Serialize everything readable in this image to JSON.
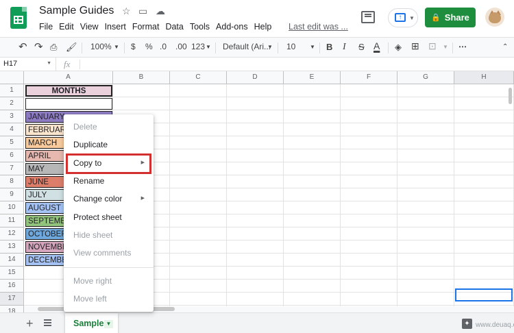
{
  "header": {
    "doc_title": "Sample Guides",
    "menu": [
      "File",
      "Edit",
      "View",
      "Insert",
      "Format",
      "Data",
      "Tools",
      "Add-ons",
      "Help"
    ],
    "last_edit": "Last edit was ...",
    "share_label": "Share"
  },
  "toolbar": {
    "zoom": "100%",
    "currency": "$",
    "percent": "%",
    "dec_less": ".0",
    "dec_more": ".00",
    "more_formats": "123",
    "font": "Default (Ari...",
    "font_size": "10",
    "bold": "B",
    "italic": "I",
    "strike": "S",
    "text_color": "A"
  },
  "formula_bar": {
    "name_box": "H17",
    "fx_label": "fx"
  },
  "grid": {
    "columns": [
      "A",
      "B",
      "C",
      "D",
      "E",
      "F",
      "G",
      "H"
    ],
    "rows": [
      "1",
      "2",
      "3",
      "4",
      "5",
      "6",
      "7",
      "8",
      "9",
      "10",
      "11",
      "12",
      "13",
      "14",
      "15",
      "16",
      "17",
      "18"
    ],
    "cells": [
      {
        "row": 1,
        "text": "MONTHS",
        "bg": "#ead1dc"
      },
      {
        "row": 2,
        "text": "",
        "bg": "#ffffff"
      },
      {
        "row": 3,
        "text": "JANUARY",
        "bg": "#8e7cc3"
      },
      {
        "row": 4,
        "text": "FEBRUARY",
        "bg": "#fce5cd"
      },
      {
        "row": 5,
        "text": "MARCH",
        "bg": "#f9cb9c"
      },
      {
        "row": 6,
        "text": "APRIL",
        "bg": "#e6b8af"
      },
      {
        "row": 7,
        "text": "MAY",
        "bg": "#b7b7b7"
      },
      {
        "row": 8,
        "text": "JUNE",
        "bg": "#dd7e6b"
      },
      {
        "row": 9,
        "text": "JULY",
        "bg": "#d0e0e3"
      },
      {
        "row": 10,
        "text": "AUGUST",
        "bg": "#a4c2f4"
      },
      {
        "row": 11,
        "text": "SEPTEMBER",
        "bg": "#93c47d"
      },
      {
        "row": 12,
        "text": "OCTOBER",
        "bg": "#6fa8dc"
      },
      {
        "row": 13,
        "text": "NOVEMBER",
        "bg": "#d5a6bd"
      },
      {
        "row": 14,
        "text": "DECEMBER",
        "bg": "#a4c2f4"
      }
    ]
  },
  "context_menu": {
    "items": [
      {
        "label": "Delete",
        "disabled": true
      },
      {
        "label": "Duplicate",
        "disabled": false
      },
      {
        "label": "Copy to",
        "disabled": false,
        "submenu": true
      },
      {
        "label": "Rename",
        "disabled": false
      },
      {
        "label": "Change color",
        "disabled": false,
        "submenu": true
      },
      {
        "label": "Protect sheet",
        "disabled": false
      },
      {
        "label": "Hide sheet",
        "disabled": true
      },
      {
        "label": "View comments",
        "disabled": true
      },
      {
        "label": "Move right",
        "disabled": true
      },
      {
        "label": "Move left",
        "disabled": true
      }
    ]
  },
  "bottom": {
    "sheet_tab": "Sample",
    "watermark": "www.deuaq.com"
  },
  "colors": {
    "accent": "#1a73e8",
    "share": "#1e8e3e",
    "highlight": "#d32f2f",
    "sheet_tab_text": "#188038"
  }
}
